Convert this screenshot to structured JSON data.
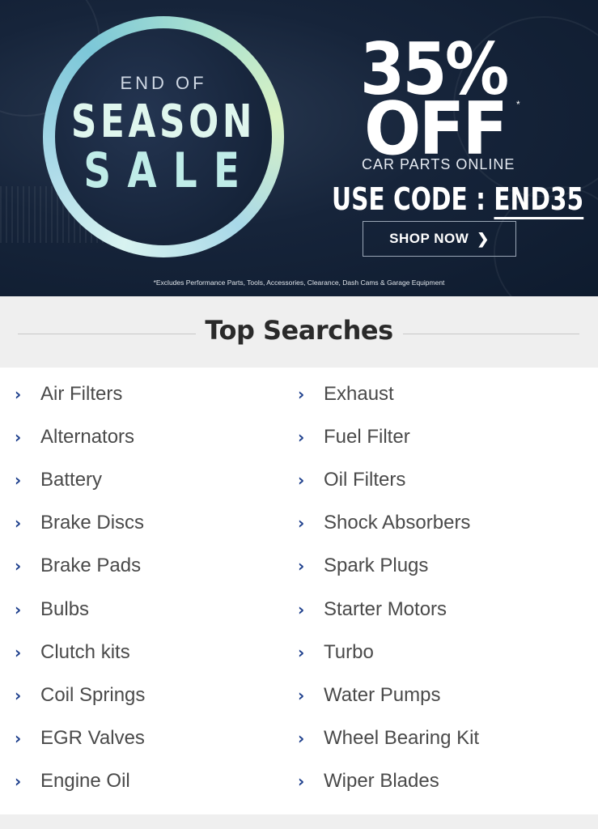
{
  "banner": {
    "end_of": "END OF",
    "season": "SEASON",
    "sale": "SALE",
    "discount": "35%",
    "off": "OFF",
    "asterisk": "*",
    "subtitle": "CAR PARTS ONLINE",
    "code_prefix": "USE CODE :",
    "code": "END35",
    "shop_button": "SHOP NOW",
    "disclaimer": "*Excludes Performance Parts, Tools, Accessories, Clearance, Dash Cams & Garage Equipment"
  },
  "top_searches": {
    "title": "Top Searches",
    "left": [
      "Air Filters",
      "Alternators",
      "Battery",
      "Brake Discs",
      "Brake Pads",
      "Bulbs",
      "Clutch kits",
      "Coil Springs",
      "EGR Valves",
      "Engine Oil"
    ],
    "right": [
      "Exhaust",
      "Fuel Filter",
      "Oil Filters",
      "Shock Absorbers",
      "Spark Plugs",
      "Starter Motors",
      "Turbo",
      "Water Pumps",
      "Wheel Bearing Kit",
      "Wiper Blades"
    ]
  },
  "colors": {
    "banner_bg": "#16243a",
    "chevron": "#1c3e8c",
    "text": "#4a4a4a"
  }
}
